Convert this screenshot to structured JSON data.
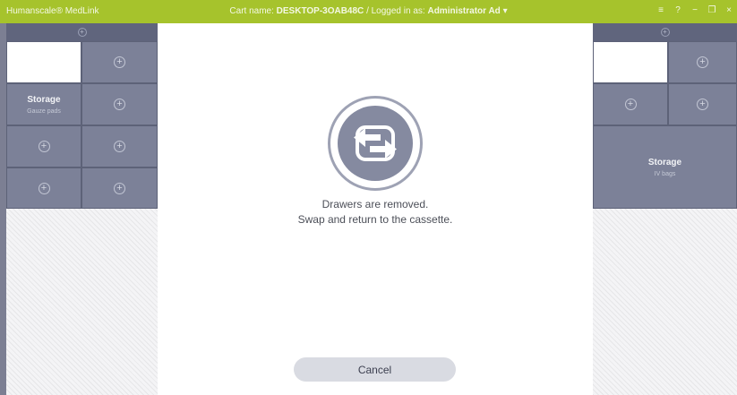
{
  "titlebar": {
    "app_name": "Humanscale® MedLink",
    "cart_label": "Cart name:",
    "cart_name": "DESKTOP-3OAB48C",
    "separator": "/",
    "logged_label": "Logged in as:",
    "user_name": "Administrator Ad",
    "user_caret": "▾",
    "menu_icon": "≡",
    "help_icon": "?",
    "minimize_icon": "−",
    "restore_icon": "❐",
    "close_icon": "×"
  },
  "left_cart": {
    "head_icon": "+",
    "cells": [
      {
        "type": "empty-white"
      },
      {
        "type": "add",
        "icon": "+"
      },
      {
        "type": "storage",
        "label": "Storage",
        "sub": "Gauze pads"
      },
      {
        "type": "add",
        "icon": "+"
      },
      {
        "type": "add",
        "icon": "+"
      },
      {
        "type": "add",
        "icon": "+"
      },
      {
        "type": "add",
        "icon": "+"
      },
      {
        "type": "add",
        "icon": "+"
      }
    ]
  },
  "right_cart": {
    "head_icon": "+",
    "cells": [
      {
        "type": "empty-white"
      },
      {
        "type": "add",
        "icon": "+"
      },
      {
        "type": "add",
        "icon": "+"
      },
      {
        "type": "add",
        "icon": "+"
      },
      {
        "type": "storage",
        "label": "Storage",
        "sub": "IV bags"
      }
    ]
  },
  "modal": {
    "icon": "swap-arrows-icon",
    "line1": "Drawers are removed.",
    "line2": "Swap and return to the cassette.",
    "cancel_label": "Cancel"
  },
  "colors": {
    "titlebar": "#a6c32c",
    "cart_header": "#60657d",
    "cell": "#7c8198",
    "button": "#d9dbe2"
  }
}
